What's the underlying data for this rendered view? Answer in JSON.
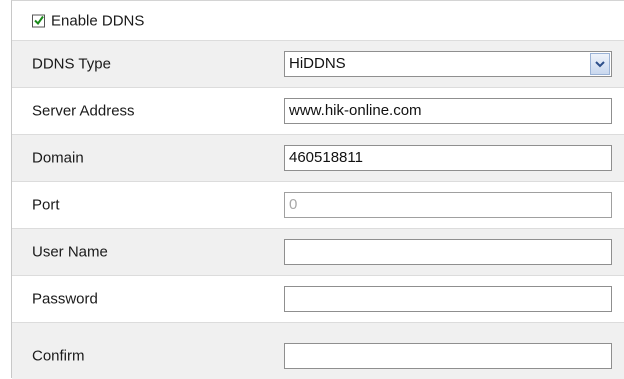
{
  "ddns": {
    "enable_label": "Enable DDNS",
    "enable_checked": true,
    "fields": {
      "type_label": "DDNS Type",
      "type_value": "HiDDNS",
      "server_label": "Server Address",
      "server_value": "www.hik-online.com",
      "domain_label": "Domain",
      "domain_value": "460518811",
      "port_label": "Port",
      "port_value": "0",
      "username_label": "User Name",
      "username_value": "",
      "password_label": "Password",
      "password_value": "",
      "confirm_label": "Confirm",
      "confirm_value": ""
    }
  },
  "colors": {
    "shaded_row": "#f0f0f0",
    "checkmark": "#1a8a1a",
    "disabled_text": "#a8a8a8"
  }
}
